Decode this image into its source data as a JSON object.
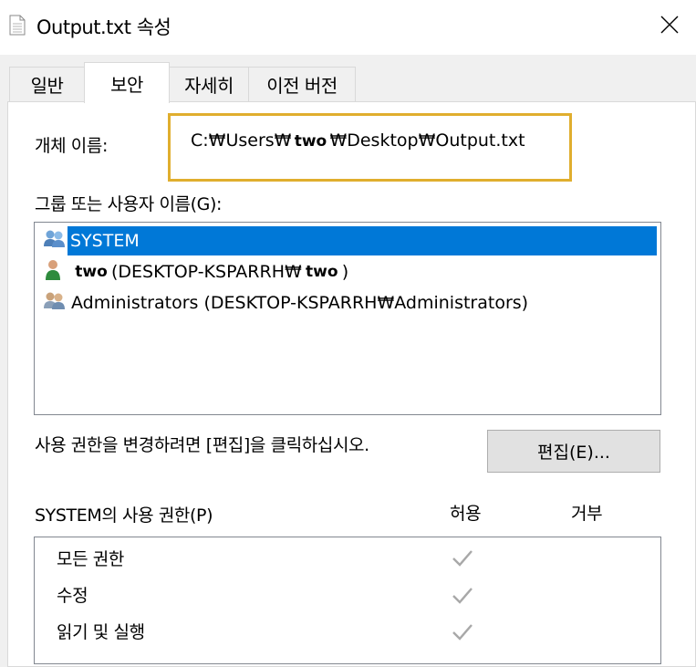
{
  "window": {
    "title": "Output.txt 속성",
    "icon": "document-icon"
  },
  "tabs": [
    {
      "label": "일반"
    },
    {
      "label": "보안"
    },
    {
      "label": "자세히"
    },
    {
      "label": "이전 버전"
    }
  ],
  "active_tab": "보안",
  "object": {
    "label": "개체 이름:",
    "path_prefix": "C:₩Users₩",
    "path_redacted": "two",
    "path_suffix": "₩Desktop₩Output.txt"
  },
  "groups": {
    "label": "그룹 또는 사용자 이름(G):",
    "items": [
      {
        "label": "SYSTEM",
        "icon": "group-users-icon",
        "selected": true
      },
      {
        "label_prefix": "",
        "redacted_name": "two",
        "label_mid": " (DESKTOP-KSPARRH₩",
        "redacted_name2": "two",
        "label_suffix": " )",
        "icon": "single-user-icon"
      },
      {
        "label": "Administrators (DESKTOP-KSPARRH₩Administrators)",
        "icon": "group-users-icon"
      }
    ]
  },
  "edit_hint": "사용 권한을 변경하려면 [편집]을 클릭하십시오.",
  "edit_button": "편집(E)...",
  "permissions": {
    "title": "SYSTEM의 사용 권한(P)",
    "allow_header": "허용",
    "deny_header": "거부",
    "rows": [
      {
        "label": "모든 권한",
        "allow": true
      },
      {
        "label": "수정",
        "allow": true
      },
      {
        "label": "읽기 및 실행",
        "allow": true
      }
    ]
  },
  "colors": {
    "selection": "#0078d7",
    "highlight_border": "#e0ae2e",
    "check_gray": "#a8a8a8"
  }
}
